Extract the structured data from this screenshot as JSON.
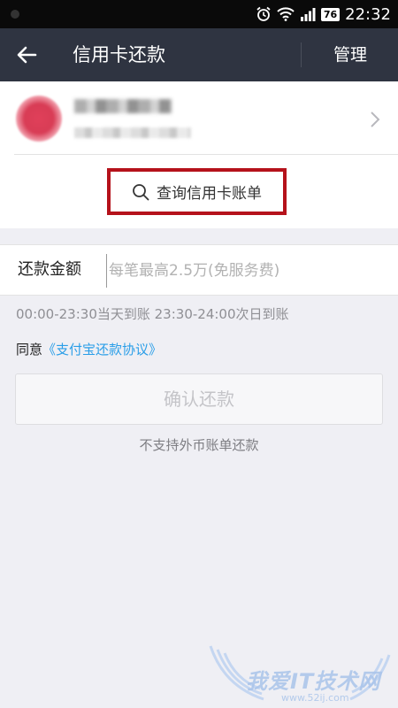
{
  "status_bar": {
    "battery": "76",
    "time": "22:32"
  },
  "app_bar": {
    "title": "信用卡还款",
    "manage_label": "管理"
  },
  "card": {
    "query_bill_label": "查询信用卡账单"
  },
  "amount": {
    "label": "还款金额",
    "placeholder": "每笔最高2.5万(免服务费)"
  },
  "arrival_note": "00:00-23:30当天到账  23:30-24:00次日到账",
  "agreement": {
    "prefix": "同意",
    "link_text": "《支付宝还款协议》"
  },
  "confirm_label": "确认还款",
  "no_foreign_note": "不支持外币账单还款",
  "watermark": {
    "text": "我爱IT技术网",
    "url": "www.52ij.com"
  },
  "colors": {
    "app_bar": "#2f3441",
    "highlight_border": "#b5121b",
    "link": "#2a9ee8",
    "background": "#efeff4"
  }
}
